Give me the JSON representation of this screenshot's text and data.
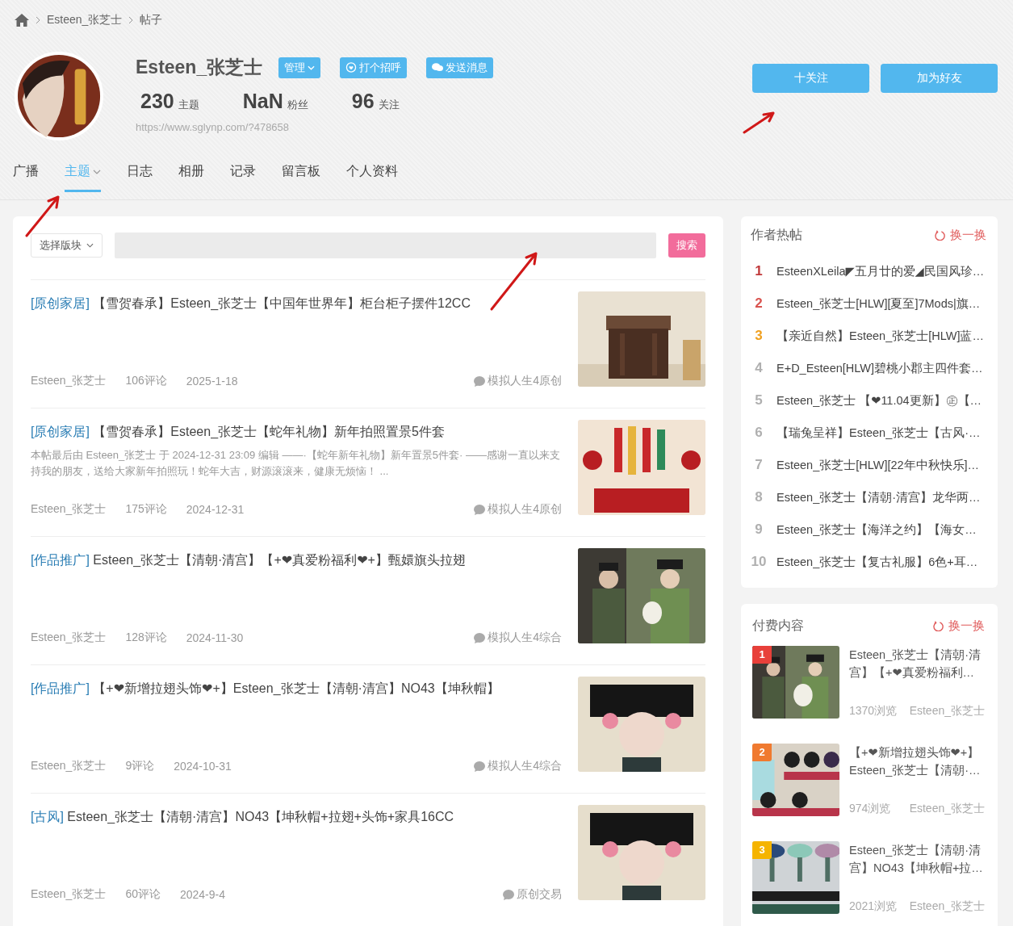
{
  "breadcrumb": [
    "Esteen_张芝士",
    "帖子"
  ],
  "profile": {
    "name": "Esteen_张芝士",
    "manage": "管理",
    "greet": "打个招呼",
    "message": "发送消息",
    "url": "https://www.sglynp.com/?478658",
    "stats": [
      {
        "value": "230",
        "label": "主题"
      },
      {
        "value": "NaN",
        "label": "粉丝"
      },
      {
        "value": "96",
        "label": "关注"
      }
    ],
    "follow": "十关注",
    "add_friend": "加为好友"
  },
  "tabs": [
    {
      "label": "广播",
      "selected": false
    },
    {
      "label": "主题",
      "selected": true,
      "dropdown": true
    },
    {
      "label": "日志",
      "selected": false
    },
    {
      "label": "相册",
      "selected": false
    },
    {
      "label": "记录",
      "selected": false
    },
    {
      "label": "留言板",
      "selected": false
    },
    {
      "label": "个人资料",
      "selected": false
    }
  ],
  "search": {
    "forum_select": "选择版块",
    "button": "搜索"
  },
  "posts": [
    {
      "category": "[原创家居]",
      "title": "【雪贺春承】Esteen_张芝士【中国年世界年】柜台柜子摆件12CC",
      "author": "Esteen_张芝士",
      "comments": "106评论",
      "date": "2025-1-18",
      "forum": "模拟人生4原创"
    },
    {
      "category": "[原创家居]",
      "title": "【雪贺春承】Esteen_张芝士【蛇年礼物】新年拍照置景5件套",
      "excerpt": "本帖最后由 Esteen_张芝士 于 2024-12-31 23:09 编辑 ——·【蛇年新年礼物】新年置景5件套· ——感谢一直以来支持我的朋友，送给大家新年拍照玩！蛇年大吉，财源滚滚来，健康无烦恼！ ...",
      "author": "Esteen_张芝士",
      "comments": "175评论",
      "date": "2024-12-31",
      "forum": "模拟人生4原创"
    },
    {
      "category": "[作品推广]",
      "title": "Esteen_张芝士【清朝·清宫】【+❤真爱粉福利❤+】甄嬛旗头拉翅",
      "author": "Esteen_张芝士",
      "comments": "128评论",
      "date": "2024-11-30",
      "forum": "模拟人生4综合"
    },
    {
      "category": "[作品推广]",
      "title": "【+❤新增拉翅头饰❤+】Esteen_张芝士【清朝·清宫】NO43【坤秋帽】",
      "author": "Esteen_张芝士",
      "comments": "9评论",
      "date": "2024-10-31",
      "forum": "模拟人生4综合"
    },
    {
      "category": "[古风]",
      "title": "Esteen_张芝士【清朝·清宫】NO43【坤秋帽+拉翅+头饰+家具16CC",
      "author": "Esteen_张芝士",
      "comments": "60评论",
      "date": "2024-9-4",
      "forum": "原创交易"
    }
  ],
  "hot": {
    "title": "作者热帖",
    "refresh": "换一换",
    "items": [
      {
        "rank": "1",
        "color": "#c0393b",
        "title": "EsteenXLeila◤五月廿的爱◢民国风珍…"
      },
      {
        "rank": "2",
        "color": "#d9534f",
        "title": "Esteen_张芝士[HLW][夏至]7Mods|旗…"
      },
      {
        "rank": "3",
        "color": "#f0a020",
        "title": "【亲近自然】Esteen_张芝士[HLW]蓝…"
      },
      {
        "rank": "4",
        "color": "#b0b0b0",
        "title": "E+D_Esteen[HLW]碧桃小郡主四件套…"
      },
      {
        "rank": "5",
        "color": "#b0b0b0",
        "title": "Esteen_张芝士 【❤11.04更新】㊣【…"
      },
      {
        "rank": "6",
        "color": "#b0b0b0",
        "title": "【瑞兔呈祥】Esteen_张芝士【古风·…"
      },
      {
        "rank": "7",
        "color": "#b0b0b0",
        "title": "Esteen_张芝士[HLW][22年中秋快乐]…"
      },
      {
        "rank": "8",
        "color": "#b0b0b0",
        "title": "Esteen_张芝士【清朝·清宫】龙华两…"
      },
      {
        "rank": "9",
        "color": "#b0b0b0",
        "title": "Esteen_张芝士【海洋之约】【海女…"
      },
      {
        "rank": "10",
        "color": "#b0b0b0",
        "title": "Esteen_张芝士【复古礼服】6色+耳…"
      }
    ]
  },
  "paid": {
    "title": "付费内容",
    "refresh": "换一换",
    "items": [
      {
        "rank": "1",
        "color": "#e8403a",
        "title": "Esteen_张芝士【清朝·清宫】【+❤真爱粉福利…",
        "views": "1370浏览",
        "author": "Esteen_张芝士"
      },
      {
        "rank": "2",
        "color": "#f07a30",
        "title": "【+❤新增拉翅头饰❤+】Esteen_张芝士【清朝·…",
        "views": "974浏览",
        "author": "Esteen_张芝士"
      },
      {
        "rank": "3",
        "color": "#f5b400",
        "title": "Esteen_张芝士【清朝·清宫】NO43【坤秋帽+拉…",
        "views": "2021浏览",
        "author": "Esteen_张芝士"
      }
    ]
  }
}
